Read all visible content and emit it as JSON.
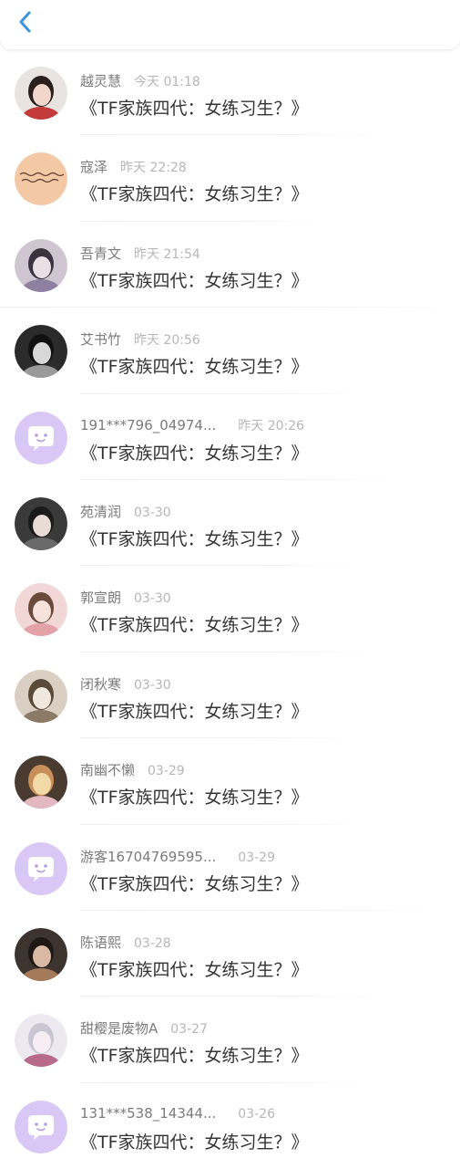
{
  "colors": {
    "accent": "#3a93e0",
    "bot_avatar_bg": "#d9c8f5",
    "bot_bubble": "#ffffff"
  },
  "header": {
    "back_icon": "chevron-left-icon"
  },
  "messages": [
    {
      "name": "越灵慧",
      "time": "今天 01:18",
      "text": "《TF家族四代：女练习生？》",
      "avatar": "photo"
    },
    {
      "name": "寇泽",
      "time": "昨天 22:28",
      "text": "《TF家族四代：女练习生？》",
      "avatar": "handwriting"
    },
    {
      "name": "吾青文",
      "time": "昨天 21:54",
      "text": "《TF家族四代：女练习生？》",
      "avatar": "photo"
    },
    {
      "name": "艾书竹",
      "time": "昨天 20:56",
      "text": "《TF家族四代：女练习生？》",
      "avatar": "photo"
    },
    {
      "name": "191***796_04974...",
      "time": "昨天 20:26",
      "text": "《TF家族四代：女练习生？》",
      "avatar": "bot"
    },
    {
      "name": "苑清润",
      "time": "03-30",
      "text": "《TF家族四代：女练习生？》",
      "avatar": "photo"
    },
    {
      "name": "郭宣朗",
      "time": "03-30",
      "text": "《TF家族四代：女练习生？》",
      "avatar": "photo"
    },
    {
      "name": "闭秋寒",
      "time": "03-30",
      "text": "《TF家族四代：女练习生？》",
      "avatar": "photo"
    },
    {
      "name": "南幽不懒",
      "time": "03-29",
      "text": "《TF家族四代：女练习生？》",
      "avatar": "photo"
    },
    {
      "name": "游客16704769595...",
      "time": "03-29",
      "text": "《TF家族四代：女练习生？》",
      "avatar": "bot"
    },
    {
      "name": "陈语熙",
      "time": "03-28",
      "text": "《TF家族四代：女练习生？》",
      "avatar": "photo"
    },
    {
      "name": "甜樱是废物A",
      "time": "03-27",
      "text": "《TF家族四代：女练习生？》",
      "avatar": "photo"
    },
    {
      "name": "131***538_14344...",
      "time": "03-26",
      "text": "《TF家族四代：女练习生？》",
      "avatar": "bot"
    }
  ]
}
